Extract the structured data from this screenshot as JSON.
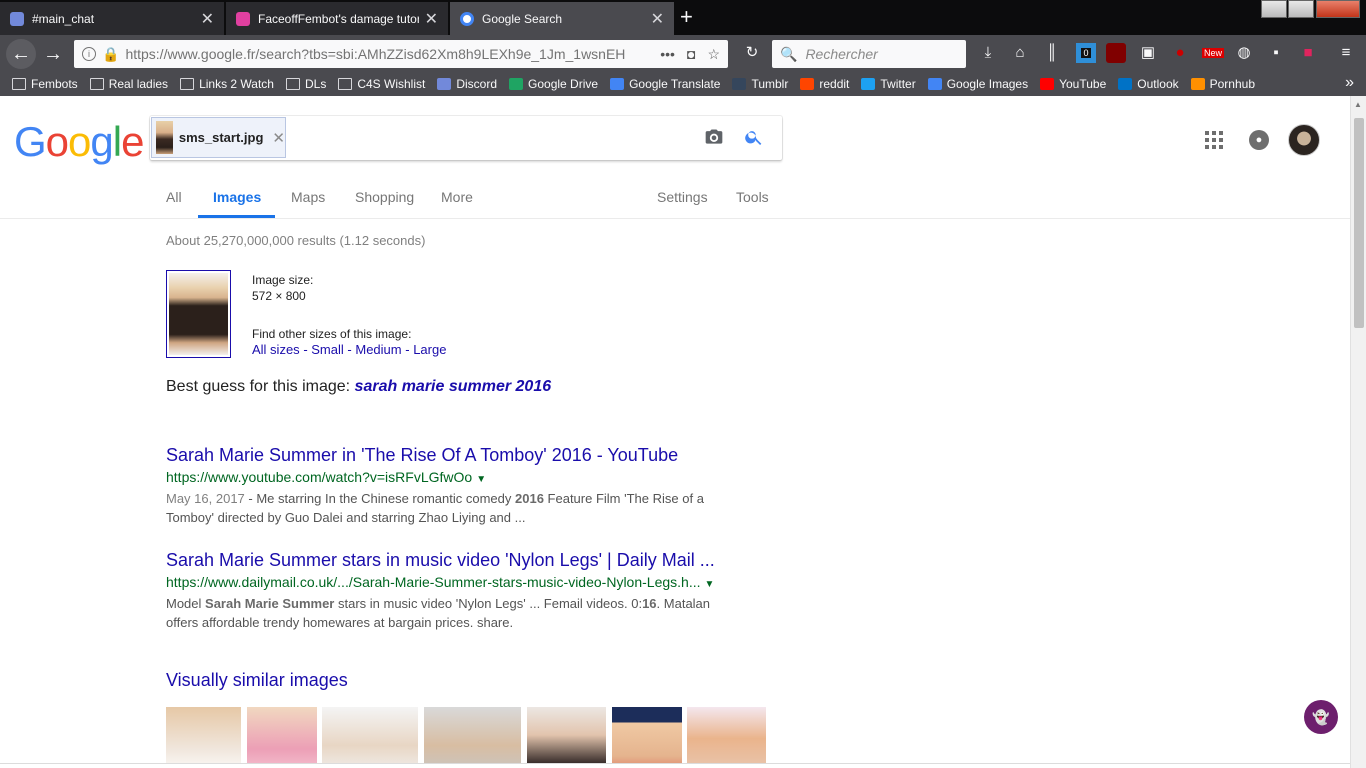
{
  "browser": {
    "tabs": [
      {
        "title": "#main_chat",
        "icon": "discord-icon",
        "color": "#7289da",
        "active": false
      },
      {
        "title": "FaceoffFembot's damage tutor",
        "icon": "fembot-icon",
        "color": "#e040a0",
        "active": false
      },
      {
        "title": "Google Search",
        "icon": "google-icon",
        "color": "#4285f4",
        "active": true
      }
    ],
    "url": "https://www.google.fr/search?tbs=sbi:AMhZZisd62Xm8h9LEXh9e_1Jm_1wsnEH",
    "search_placeholder": "Rechercher",
    "bookmarks": [
      {
        "label": "Fembots",
        "icon": "folder-icon"
      },
      {
        "label": "Real ladies",
        "icon": "folder-icon"
      },
      {
        "label": "Links 2 Watch",
        "icon": "folder-icon"
      },
      {
        "label": "DLs",
        "icon": "folder-icon"
      },
      {
        "label": "C4S Wishlist",
        "icon": "folder-icon"
      },
      {
        "label": "Discord",
        "icon": "discord-icon",
        "color": "#7289da"
      },
      {
        "label": "Google Drive",
        "icon": "drive-icon",
        "color": "#1fa463"
      },
      {
        "label": "Google Translate",
        "icon": "translate-icon",
        "color": "#4285f4"
      },
      {
        "label": "Tumblr",
        "icon": "tumblr-icon",
        "color": "#35465c"
      },
      {
        "label": "reddit",
        "icon": "reddit-icon",
        "color": "#ff4500"
      },
      {
        "label": "Twitter",
        "icon": "twitter-icon",
        "color": "#1da1f2"
      },
      {
        "label": "Google Images",
        "icon": "google-icon",
        "color": "#4285f4"
      },
      {
        "label": "YouTube",
        "icon": "youtube-icon",
        "color": "#ff0000"
      },
      {
        "label": "Outlook",
        "icon": "outlook-icon",
        "color": "#0072c6"
      },
      {
        "label": "Pornhub",
        "icon": "pornhub-icon",
        "color": "#ff9000"
      }
    ],
    "badge_count": "0",
    "badge_new": "New"
  },
  "google": {
    "logo": "Google",
    "chip_label": "sms_start.jpg",
    "tabs": [
      "All",
      "Images",
      "Maps",
      "Shopping",
      "More"
    ],
    "right_tabs": [
      "Settings",
      "Tools"
    ],
    "active_tab": "Images"
  },
  "results": {
    "stats": "About 25,270,000,000 results (1.12 seconds)",
    "image_size_label": "Image size:",
    "image_size_value": "572 × 800",
    "other_sizes_label": "Find other sizes of this image:",
    "size_links": [
      "All sizes",
      "Small",
      "Medium",
      "Large"
    ],
    "best_guess_label": "Best guess for this image:",
    "best_guess_value": "sarah marie summer 2016",
    "items": [
      {
        "title": "Sarah Marie Summer in 'The Rise Of A Tomboy' 2016 - YouTube",
        "url": "https://www.youtube.com/watch?v=isRFvLGfwOo",
        "date": "May 16, 2017",
        "snippet_a": " - Me starring In the Chinese romantic comedy ",
        "snippet_b": "2016",
        "snippet_c": " Feature Film 'The Rise of a Tomboy' directed by Guo Dalei and starring Zhao Liying and ..."
      },
      {
        "title": "Sarah Marie Summer stars in music video 'Nylon Legs' | Daily Mail ...",
        "url": "https://www.dailymail.co.uk/.../Sarah-Marie-Summer-stars-music-video-Nylon-Legs.h...",
        "snippet_pre": "Model ",
        "snippet_bold1": "Sarah Marie Summer",
        "snippet_mid": " stars in music video 'Nylon Legs' ... Femail videos. 0:",
        "snippet_bold2": "16",
        "snippet_post": ". Matalan offers affordable trendy homewares at bargain prices. share."
      }
    ],
    "visually_similar": "Visually similar images"
  }
}
